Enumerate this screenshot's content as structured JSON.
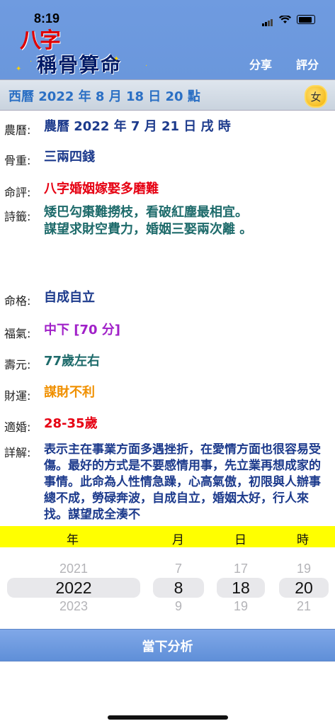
{
  "status": {
    "time": "8:19"
  },
  "header": {
    "logo_red": "八字",
    "logo_main": "稱骨算命",
    "share_label": "分享",
    "rate_label": "評分"
  },
  "datebar": {
    "solar": "西曆 2022 年 8 月 18 日 20 點",
    "gender": "女"
  },
  "rows": [
    {
      "label": "農曆:",
      "value": "農曆 2022 年 7 月 21 日 戌 時",
      "color": "#1c3a8c"
    },
    {
      "label": "骨重:",
      "value": "三兩四錢",
      "color": "#1c3a8c"
    },
    {
      "label": "命評:",
      "value": "八字婚姻嫁娶多磨難",
      "color": "#e60012"
    },
    {
      "label": "詩籤:",
      "value": "矮巴勾棗難撈枝，看破紅塵最相宜。",
      "value2": "謀望求財空費力，婚姻三娶兩次離 。",
      "color": "#1e6b6b"
    },
    {
      "label": "命格:",
      "value": "自成自立",
      "color": "#1c3a8c"
    },
    {
      "label": "福氣:",
      "value": "中下 [70 分]",
      "color": "#a020c8"
    },
    {
      "label": "壽元:",
      "value": "77歲左右",
      "color": "#1e6b6b"
    },
    {
      "label": "財運:",
      "value": "謀財不利",
      "color": "#f09000"
    },
    {
      "label": "適婚:",
      "value": "28-35歲",
      "color": "#e60012"
    },
    {
      "label": "詳解:",
      "value": "表示主在事業方面多遇挫折，在愛情方面也很容易受傷。最好的方式是不要感情用事，先立業再想成家的事情。此命為人性情急躁，心高氣傲，初限與人辦事總不成，勞碌奔波，自成自立，婚姻太好，行人來找。謀望成全湊不",
      "color": "#1c3a8c"
    }
  ],
  "picker": {
    "headers": [
      "年",
      "月",
      "日",
      "時"
    ],
    "columns": [
      {
        "prev": "2021",
        "selected": "2022",
        "next": "2023"
      },
      {
        "prev": "7",
        "selected": "8",
        "next": "9"
      },
      {
        "prev": "17",
        "selected": "18",
        "next": "19"
      },
      {
        "prev": "19",
        "selected": "20",
        "next": "21"
      }
    ]
  },
  "action": {
    "analyze_label": "當下分析"
  }
}
